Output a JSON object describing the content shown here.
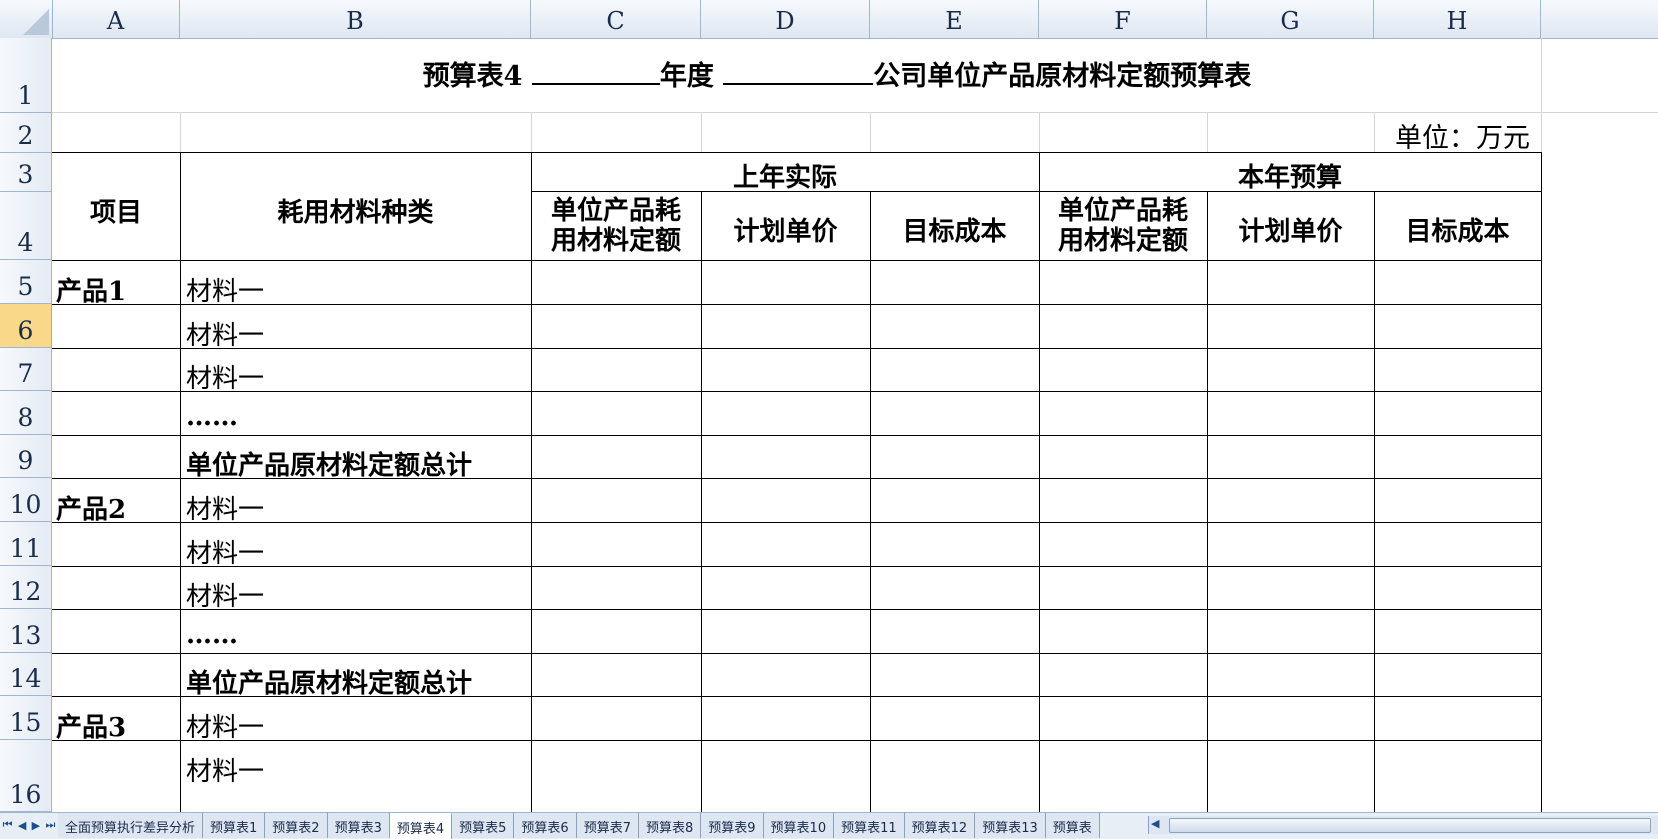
{
  "columns": [
    "A",
    "B",
    "C",
    "D",
    "E",
    "F",
    "G",
    "H"
  ],
  "rows": [
    "1",
    "2",
    "3",
    "4",
    "5",
    "6",
    "7",
    "8",
    "9",
    "10",
    "11",
    "12",
    "13",
    "14",
    "15",
    "16"
  ],
  "active_row": "6",
  "title": {
    "prefix": "预算表4",
    "middle": "年度",
    "suffix": "公司单位产品原材料定额预算表"
  },
  "unit_label": "单位：万元",
  "header": {
    "item": "项目",
    "material_type": "耗用材料种类",
    "last_year": "上年实际",
    "this_year": "本年预算",
    "quota": "单位产品耗\n用材料定额",
    "quota_line1": "单位产品耗",
    "quota_line2": "用材料定额",
    "plan_price": "计划单价",
    "target_cost": "目标成本"
  },
  "body_rows": [
    {
      "row": "5",
      "item": "产品1",
      "material": "材料一"
    },
    {
      "row": "6",
      "item": "",
      "material": "材料一"
    },
    {
      "row": "7",
      "item": "",
      "material": "材料一"
    },
    {
      "row": "8",
      "item": "",
      "material": "……"
    },
    {
      "row": "9",
      "item": "",
      "material": "单位产品原材料定额总计"
    },
    {
      "row": "10",
      "item": "产品2",
      "material": "材料一"
    },
    {
      "row": "11",
      "item": "",
      "material": "材料一"
    },
    {
      "row": "12",
      "item": "",
      "material": "材料一"
    },
    {
      "row": "13",
      "item": "",
      "material": "……"
    },
    {
      "row": "14",
      "item": "",
      "material": "单位产品原材料定额总计"
    },
    {
      "row": "15",
      "item": "产品3",
      "material": "材料一"
    },
    {
      "row": "16",
      "item": "",
      "material": "材料一"
    }
  ],
  "sheet_tabs": [
    "全面预算执行差异分析",
    "预算表1",
    "预算表2",
    "预算表3",
    "预算表4",
    "预算表5",
    "预算表6",
    "预算表7",
    "预算表8",
    "预算表9",
    "预算表10",
    "预算表11",
    "预算表12",
    "预算表13",
    "预算表"
  ],
  "active_tab": "预算表4",
  "nav_icons": [
    "first-sheet-icon",
    "prev-sheet-icon",
    "next-sheet-icon",
    "last-sheet-icon"
  ],
  "colors": {
    "header_bg": "#dfe7f2",
    "grid": "#d4d4d4",
    "active_row": "#f9d88a"
  }
}
